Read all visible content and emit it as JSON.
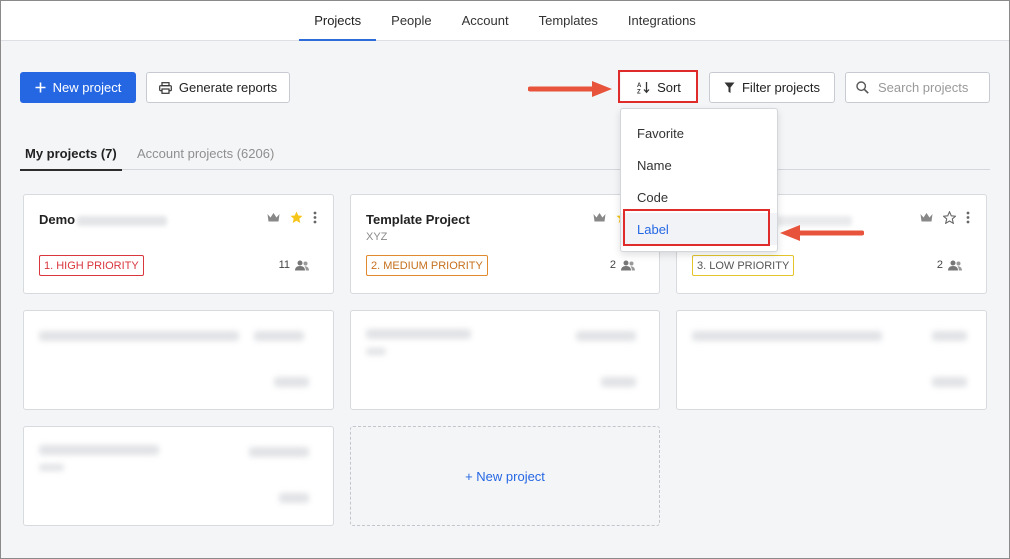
{
  "nav": {
    "tabs": [
      {
        "label": "Projects",
        "active": true
      },
      {
        "label": "People"
      },
      {
        "label": "Account"
      },
      {
        "label": "Templates"
      },
      {
        "label": "Integrations"
      }
    ]
  },
  "toolbar": {
    "new_project_label": "New project",
    "generate_reports_label": "Generate reports",
    "sort_label": "Sort",
    "filter_label": "Filter projects",
    "search_placeholder": "Search projects"
  },
  "sort_menu": {
    "items": [
      "Favorite",
      "Name",
      "Code",
      "Label"
    ],
    "selected": "Label"
  },
  "subtabs": {
    "my_projects": "My projects (7)",
    "account_projects": "Account projects (6206)"
  },
  "cards": [
    {
      "title": "Demo",
      "badge": "1. HIGH PRIORITY",
      "members": "11",
      "favorite": true
    },
    {
      "title": "Template Project",
      "code": "XYZ",
      "badge": "2. MEDIUM PRIORITY",
      "members": "2",
      "favorite": true
    },
    {
      "title": "",
      "badge": "3. LOW PRIORITY",
      "members": "2",
      "favorite": false
    }
  ],
  "new_project_card_label": "+ New project",
  "colors": {
    "primary": "#2567e3",
    "highlight": "#e02b2b",
    "high_priority": "#d9363e",
    "medium_priority": "#e08a2e",
    "low_priority": "#e3c42b",
    "star": "#f5c518"
  }
}
